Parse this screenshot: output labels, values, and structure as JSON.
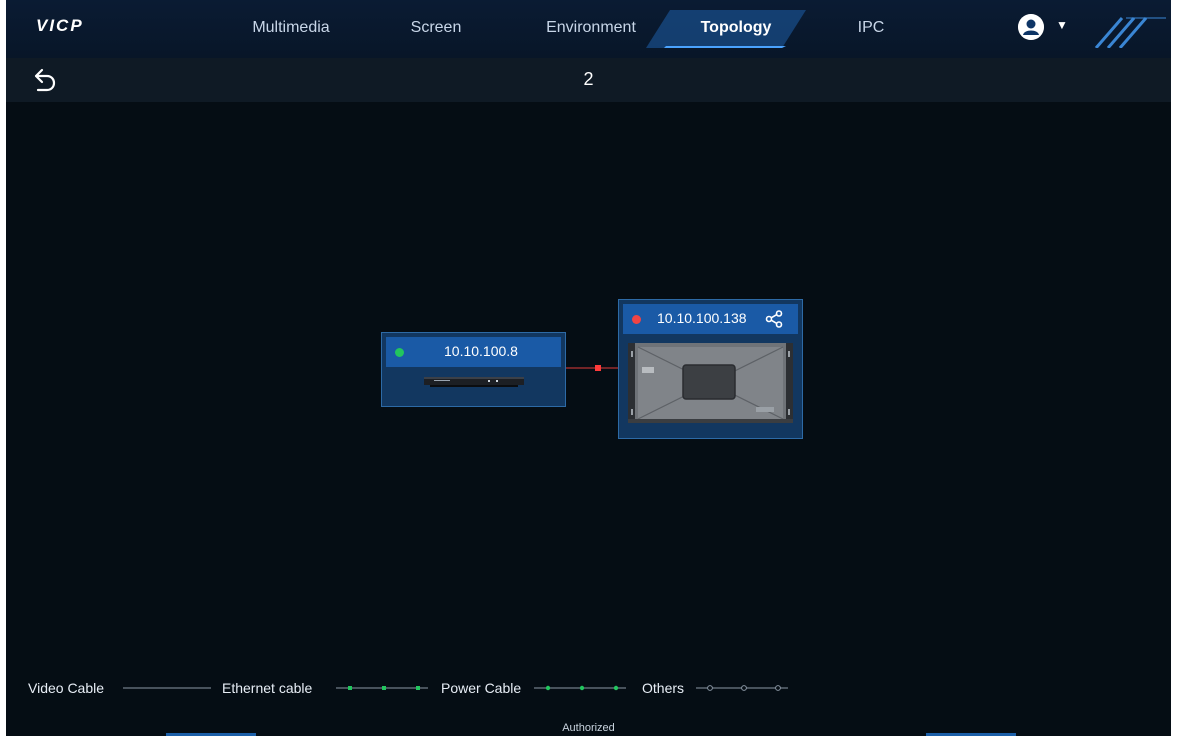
{
  "app": {
    "brand": "VICP"
  },
  "nav": {
    "tabs": [
      {
        "label": "Multimedia"
      },
      {
        "label": "Screen"
      },
      {
        "label": "Environment"
      },
      {
        "label": "Topology"
      },
      {
        "label": "IPC"
      }
    ],
    "active": "Topology"
  },
  "header": {
    "title": "2"
  },
  "topology": {
    "nodes": [
      {
        "ip": "10.10.100.8",
        "status": "online",
        "status_color": "#22c55e"
      },
      {
        "ip": "10.10.100.138",
        "status": "offline",
        "status_color": "#ef4444"
      }
    ],
    "link_color": "#e03a3a"
  },
  "legend": {
    "video": "Video Cable",
    "ethernet": "Ethernet cable",
    "power": "Power Cable",
    "others": "Others",
    "ethernet_color": "#22c55e"
  },
  "footer": {
    "text": "Authorized"
  }
}
